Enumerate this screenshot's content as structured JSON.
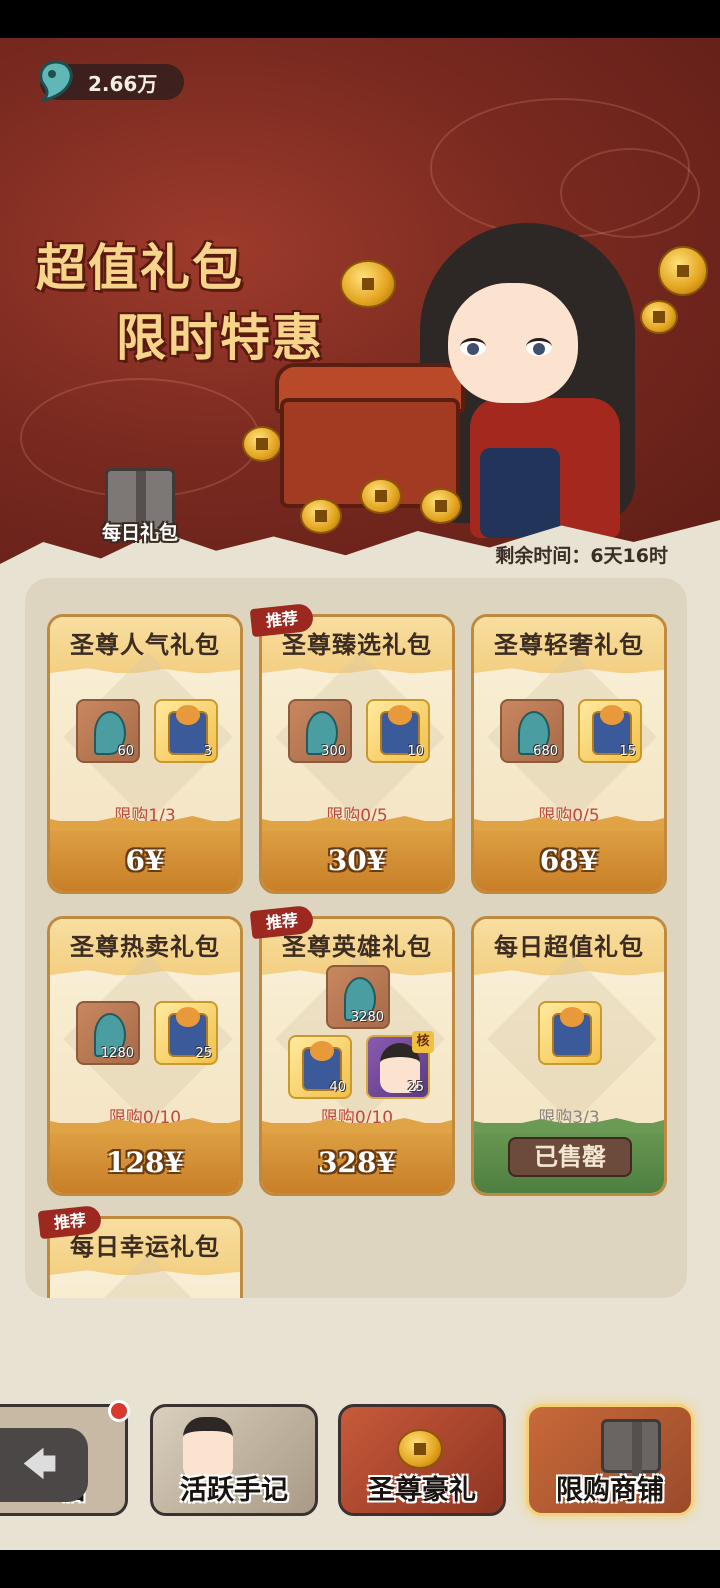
{
  "currency": {
    "icon": "spirit-gem-icon",
    "amount": "2.66万"
  },
  "banner": {
    "line1": "超值礼包",
    "line2": "限时特惠"
  },
  "daily_gift": {
    "label": "每日礼包"
  },
  "timer": "剩余时间：6天16时",
  "cards": [
    {
      "title": "圣尊人气礼包",
      "recommended": false,
      "items": [
        {
          "type": "gem",
          "count": "60"
        },
        {
          "type": "ticket",
          "count": "3"
        }
      ],
      "limit": "限购1/3",
      "price": "6¥"
    },
    {
      "title": "圣尊臻选礼包",
      "recommended": true,
      "items": [
        {
          "type": "gem",
          "count": "300"
        },
        {
          "type": "ticket",
          "count": "10"
        }
      ],
      "limit": "限购0/5",
      "price": "30¥"
    },
    {
      "title": "圣尊轻奢礼包",
      "recommended": false,
      "items": [
        {
          "type": "gem",
          "count": "680"
        },
        {
          "type": "ticket",
          "count": "15"
        }
      ],
      "limit": "限购0/5",
      "price": "68¥"
    },
    {
      "title": "圣尊热卖礼包",
      "recommended": false,
      "items": [
        {
          "type": "gem",
          "count": "1280"
        },
        {
          "type": "ticket",
          "count": "25"
        }
      ],
      "limit": "限购0/10",
      "price": "128¥"
    },
    {
      "title": "圣尊英雄礼包",
      "recommended": true,
      "items": [
        {
          "type": "gem",
          "count": "3280"
        },
        {
          "type": "ticket",
          "count": "40"
        },
        {
          "type": "hero",
          "count": "25",
          "tag": "核"
        }
      ],
      "limit": "限购0/10",
      "price": "328¥"
    },
    {
      "title": "每日超值礼包",
      "recommended": false,
      "items": [
        {
          "type": "ticket",
          "count": ""
        }
      ],
      "limit": "限购3/3",
      "sold_out": "已售罄"
    },
    {
      "title": "每日幸运礼包",
      "recommended": true
    }
  ],
  "recommend_label": "推荐",
  "nav": {
    "tabs": [
      {
        "label": "临",
        "badge": true
      },
      {
        "label": "活跃手记"
      },
      {
        "label": "圣尊豪礼"
      },
      {
        "label": "限购商铺",
        "active": true
      }
    ]
  },
  "colors": {
    "banner": "#7a2a20",
    "accent": "#f5d17a",
    "limit_text": "#c04a3c",
    "price_bar": "#d69238",
    "sold_bar": "#5e8c4a"
  }
}
